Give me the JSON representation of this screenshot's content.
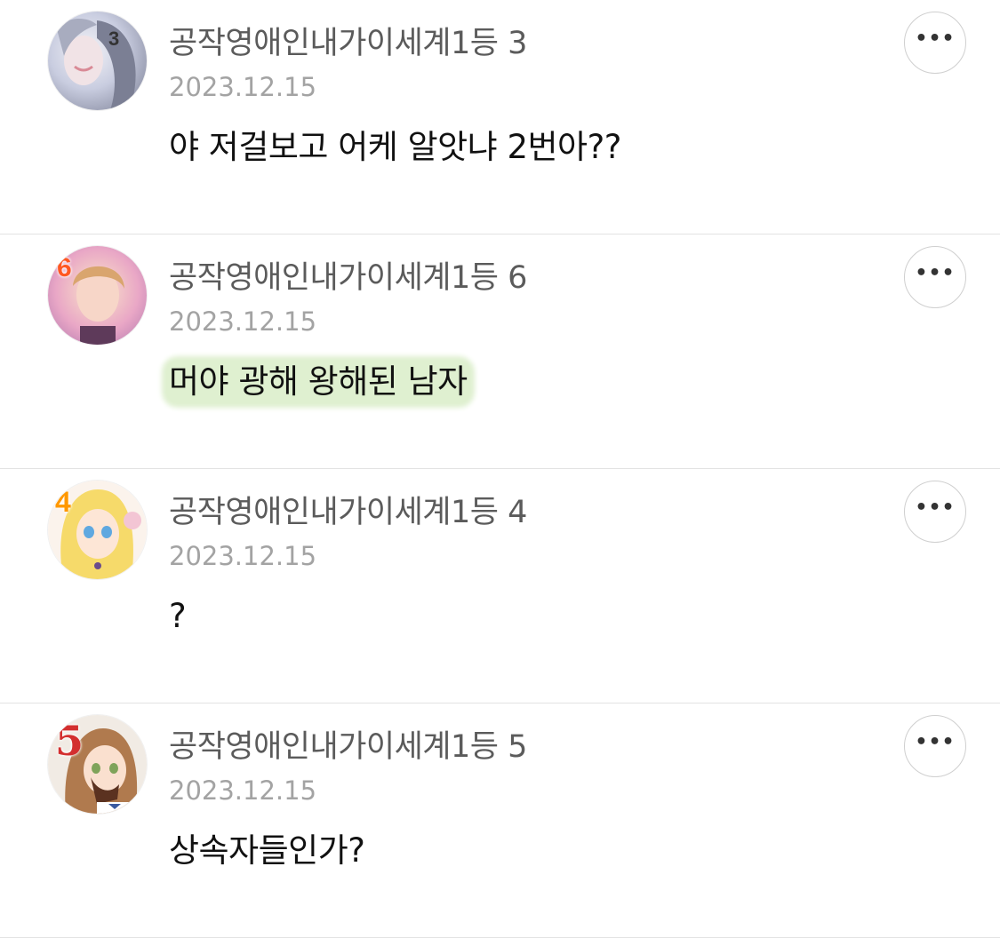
{
  "comments": [
    {
      "author": "공작영애인내가이세계1등 3",
      "date": "2023.12.15",
      "text": "야 저걸보고 어케 알앗냐 2번아??",
      "badge": "3",
      "badge_color": "#8bc34a",
      "avatar_icon": "avatar-icon",
      "more_icon": "•••"
    },
    {
      "author": "공작영애인내가이세계1등 6",
      "date": "2023.12.15",
      "text": "머야 광해 왕해된 남자",
      "highlighted": true,
      "highlight_color": "#dff0d0",
      "badge": "6",
      "badge_color": "#ff5722",
      "avatar_icon": "avatar-icon",
      "more_icon": "•••"
    },
    {
      "author": "공작영애인내가이세계1등 4",
      "date": "2023.12.15",
      "text": "?",
      "badge": "4",
      "badge_color": "#ff9800",
      "avatar_icon": "avatar-icon",
      "more_icon": "•••"
    },
    {
      "author": "공작영애인내가이세계1등 5",
      "date": "2023.12.15",
      "text": "상속자들인가?",
      "badge": "5",
      "badge_color": "#d32f2f",
      "avatar_icon": "avatar-icon",
      "more_icon": "•••"
    }
  ]
}
